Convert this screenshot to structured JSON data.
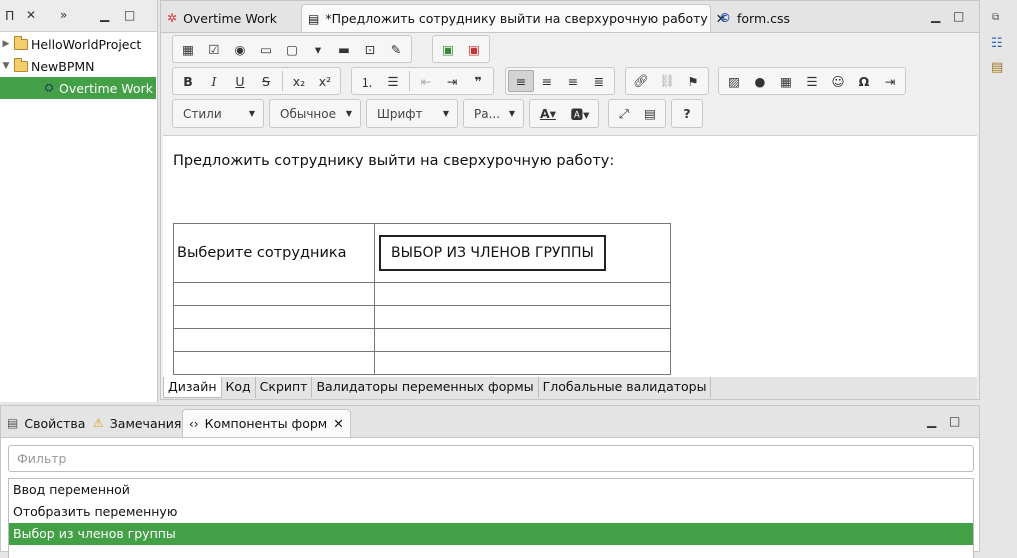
{
  "explorer": {
    "tab_label": "П",
    "tree": [
      {
        "label": "HelloWorldProject",
        "expanded": false
      },
      {
        "label": "NewBPMN",
        "expanded": true
      },
      {
        "label": "Overtime Work",
        "selected": true
      }
    ]
  },
  "editor": {
    "tabs": [
      {
        "label": "Overtime Work"
      },
      {
        "label": "*Предложить сотруднику выйти на сверхурочную работу",
        "active": true
      },
      {
        "label": "form.css"
      }
    ],
    "dropdowns": {
      "styles": "Стили",
      "format": "Обычное",
      "font": "Шрифт",
      "size": "Ра..."
    },
    "content": {
      "heading": "Предложить сотруднику выйти на сверхурочную работу:",
      "row_label": "Выберите сотрудника",
      "select_widget": "ВЫБОР ИЗ ЧЛЕНОВ ГРУППЫ"
    },
    "bottom_tabs": [
      "Дизайн",
      "Код",
      "Скрипт",
      "Валидаторы переменных формы",
      "Глобальные валидаторы"
    ]
  },
  "panel": {
    "tabs": [
      "Свойства",
      "Замечания",
      "Компоненты форм"
    ],
    "filter_placeholder": "Фильтр",
    "items": [
      "Ввод переменной",
      "Отобразить переменную",
      "Выбор из членов группы"
    ],
    "selected_item": 2
  },
  "colors": {
    "selection": "#43a047"
  }
}
